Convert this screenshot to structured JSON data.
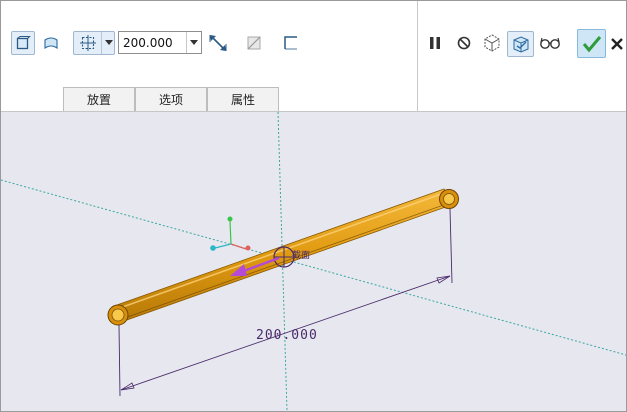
{
  "toolbar": {
    "dimension_value": "200.000"
  },
  "tabs": [
    {
      "label": "放置"
    },
    {
      "label": "选项"
    },
    {
      "label": "属性"
    }
  ],
  "canvas": {
    "section_label": "截面",
    "dimension_text": "200.000"
  },
  "colors": {
    "pipe": "#e09a10",
    "pipe_dark": "#b87a08",
    "viewport_bg": "#e7e8ef",
    "datum_axis": "#3aa6a0",
    "dimension": "#4a2a6a",
    "direction_arrow": "#b44ad6",
    "confirm_check": "#2e9c3a"
  },
  "icons": [
    "solid-sweep-icon",
    "surface-sweep-icon",
    "sketch-plane-icon",
    "dropdown-icon",
    "flip-dimension-icon",
    "remove-material-icon",
    "thicken-icon",
    "pause-icon",
    "no-preview-icon",
    "preview-geometry-icon",
    "verify-icon",
    "glasses-icon",
    "check-icon",
    "cancel-icon"
  ]
}
